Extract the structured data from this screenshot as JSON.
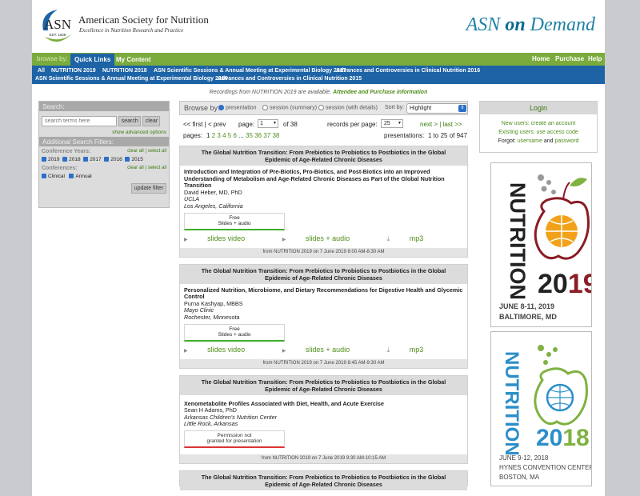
{
  "header": {
    "logo_text": "ASN",
    "logo_est": "EST. 1928",
    "org_name": "American Society for Nutrition",
    "org_tagline": "Excellence in Nutrition Research and Practice",
    "brand_a": "ASN",
    "brand_b": "on",
    "brand_c": "Demand"
  },
  "nav": {
    "browse_label": "browse by:",
    "tabs": [
      "Quick Links",
      "My Content"
    ],
    "right": [
      "Home",
      "Purchase",
      "Help"
    ]
  },
  "quicklinks": [
    "All",
    "NUTRITION 2019",
    "NUTRITION 2018",
    "ASN Scientific Sessions & Annual Meeting at Experimental Biology 2017",
    "Advances and Controversies in Clinical Nutrition 2016",
    "ASN Scientific Sessions & Annual Meeting at Experimental Biology 2016",
    "Advances and Controversies in Clinical Nutrition 2015"
  ],
  "notice": {
    "text": "Recordings from NUTRITION 2019 are available.",
    "link": "Attendee and Purchase information"
  },
  "search": {
    "title": "Search:",
    "placeholder": "search terms here",
    "search_btn": "search",
    "clear_btn": "clear",
    "advanced": "show advanced options",
    "filters_title": "Additional Search Filters:",
    "years_label": "Conference Years:",
    "clear_select": "clear all | select all",
    "years": [
      "2019",
      "2018",
      "2017",
      "2016",
      "2015"
    ],
    "conf_label": "Conferences:",
    "confs": [
      "Clinical",
      "Annual"
    ],
    "update_btn": "update filter"
  },
  "browse": {
    "label": "Browse by:",
    "options": [
      "presentation",
      "session (summary)",
      "session (with details)"
    ],
    "sort_label": "Sort by:",
    "sort_value": "Highlight"
  },
  "pager": {
    "first_prev": "<< first | < prev",
    "page_label": "page:",
    "page_value": "1",
    "of": "of 38",
    "rpp_label": "records per page:",
    "rpp_value": "25",
    "next_last": "next > | last >>",
    "pages_label": "pages:",
    "pages": [
      "1",
      "2",
      "3",
      "4",
      "5",
      "6",
      "...",
      "35",
      "36",
      "37",
      "38"
    ],
    "presentations": "presentations:",
    "range": "1 to 25 of 947"
  },
  "cards": [
    {
      "session": "The Global Nutrition Transition: From Prebiotics to Probiotics to Postbiotics in the Global Epidemic of Age-Related Chronic Diseases",
      "title": "Introduction and Integration of Pre-Biotics, Pro-Biotics, and Post-Biotics into an Improved Understanding of Metabolism and Age-Related Chronic Diseases as Part of the Global Nutrition Transition",
      "speaker": "David Heber, MD, PhD",
      "aff1": "UCLA",
      "aff2": "Los Angeles, California",
      "badge1": "Free",
      "badge2": "Slides + audio",
      "links": [
        "slides video",
        "slides + audio",
        "mp3"
      ],
      "footer": "from NUTRITION 2019 on 7 June 2019 8:00 AM-8:30 AM"
    },
    {
      "session": "The Global Nutrition Transition: From Prebiotics to Probiotics to Postbiotics in the Global Epidemic of Age-Related Chronic Diseases",
      "title": "Personalized Nutrition, Microbiome, and Dietary Recommendations for Digestive Health and Glycemic Control",
      "speaker": "Purna Kashyap, MBBS",
      "aff1": "Mayo Clinic",
      "aff2": "Rochester, Minnesota",
      "badge1": "Free",
      "badge2": "Slides + audio",
      "links": [
        "slides video",
        "slides + audio",
        "mp3"
      ],
      "footer": "from NUTRITION 2019 on 7 June 2019 8:45 AM-9:30 AM"
    },
    {
      "session": "The Global Nutrition Transition: From Prebiotics to Probiotics to Postbiotics in the Global Epidemic of Age-Related Chronic Diseases",
      "title": "Xenometabolite Profiles Associated with Diet, Health, and Acute Exercise",
      "speaker": "Sean H Adams, PhD",
      "aff1": "Arkansas Children's Nutrition Center",
      "aff2": "Little Rock, Arkansas",
      "badge1": "Permission not",
      "badge2": "granted for presentation",
      "footer": "from NUTRITION 2019 on 7 June 2019 9:30 AM-10:15 AM"
    }
  ],
  "login": {
    "title": "Login",
    "new_users": "New users: create an account",
    "existing": "Existing users: use access code",
    "forgot": "Forgot:",
    "username": "username",
    "and": "and",
    "password": "password"
  },
  "ads": [
    {
      "name": "NUTRITION",
      "year_a": "20",
      "year_b": "19",
      "dates": "JUNE 8-11, 2019",
      "place": "BALTIMORE, MD"
    },
    {
      "name": "NUTRITION",
      "year_a": "20",
      "year_b": "18",
      "dates": "JUNE 9-12, 2018",
      "venue": "HYNES CONVENTION CENTER",
      "place": "BOSTON, MA"
    }
  ],
  "colors": {
    "green": "#7aab3c",
    "blue": "#1d63a5",
    "brand": "#1f82a6",
    "ad_red": "#8b1c24",
    "ad_orange": "#f2a21a",
    "ad_green": "#7fb241",
    "ad_blue": "#2c8fc9"
  }
}
